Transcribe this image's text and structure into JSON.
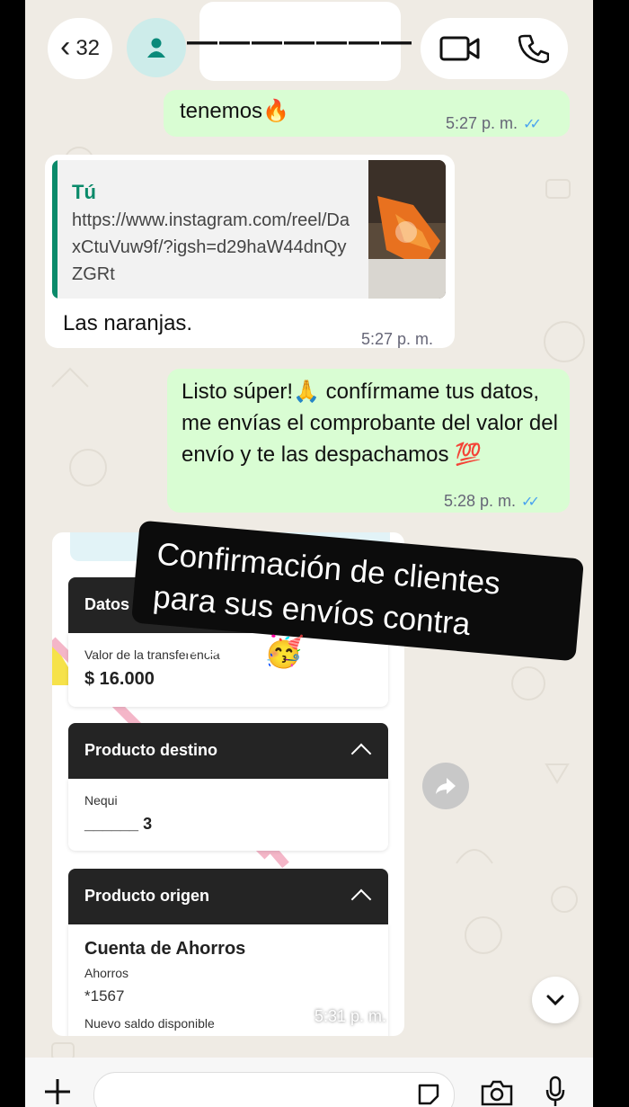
{
  "header": {
    "back_count": "32",
    "contact_name": "———————",
    "icons": [
      "chevron-left-icon",
      "person-icon",
      "video-camera-icon",
      "phone-icon"
    ]
  },
  "messages": {
    "m1": {
      "text": "tenemos🔥",
      "time": "5:27 p. m.",
      "ticks": "✓✓"
    },
    "m2": {
      "quote_author": "Tú",
      "quote_link": "https://www.instagram.com/reel/DaxCtuVuw9f/?igsh=d29haW44dnQyZGRt",
      "text": "Las naranjas.",
      "time": "5:27 p. m."
    },
    "m3": {
      "text": "Listo súper!🙏 confírmame tus datos, me envías el comprobante del valor del envío y te las despachamos 💯",
      "time": "5:28 p. m.",
      "ticks": "✓✓"
    },
    "m4": {
      "time": "5:31 p. m.",
      "receipt": {
        "section1_title": "Datos de la tr",
        "label_value": "Valor de la transferencia",
        "amount": "$ 16.000",
        "section2_title": "Producto destino",
        "dest_name": "Nequi",
        "dest_number": "______ 3",
        "section3_title": "Producto origen",
        "origin_title": "Cuenta de Ahorros",
        "origin_type": "Ahorros",
        "origin_number": "*1567",
        "balance_label": "Nuevo saldo disponible"
      }
    }
  },
  "sticker": {
    "text": "Confirmación de clientes para sus envíos contra entrega!🥳"
  },
  "composer": {
    "icons": [
      "plus-icon",
      "sticker-icon",
      "camera-icon",
      "microphone-icon"
    ]
  },
  "colors": {
    "outgoing": "#d9fdd3",
    "incoming": "#ffffff",
    "wallpaper": "#efebe4",
    "accent": "#0a8a6a",
    "read_ticks": "#4aa3ef"
  }
}
